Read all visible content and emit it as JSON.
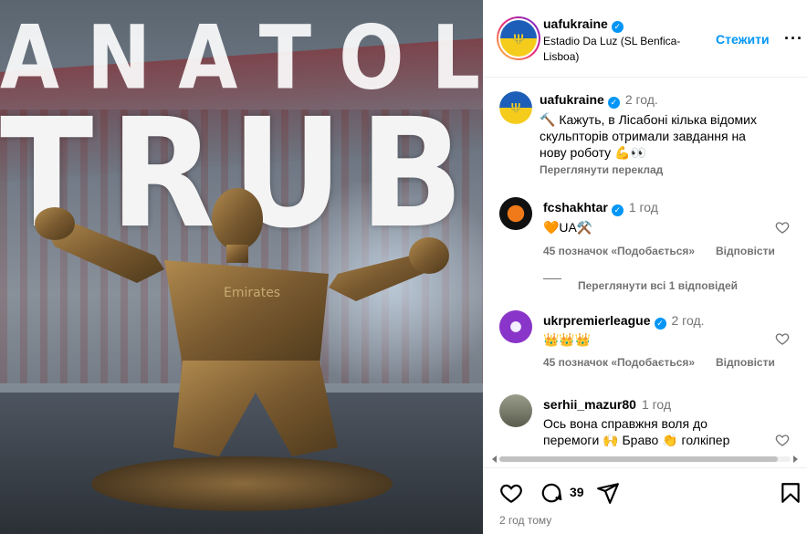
{
  "media": {
    "title_line1": "ANATOLIY",
    "title_line2": "TRUBIN",
    "shirt_text": "Emirates FLY BETTER"
  },
  "header": {
    "username": "uafukraine",
    "location": "Estadio Da Luz (SL Benfica-Lisboa)",
    "follow_label": "Стежити",
    "more_label": "···"
  },
  "caption": {
    "username": "uafukraine",
    "time": "2 год.",
    "text": "🔨 Кажуть, в Лісабоні кілька відомих скульпторів отримали завдання на нову роботу 💪👀",
    "translate_label": "Переглянути переклад"
  },
  "comments": [
    {
      "username": "fcshakhtar",
      "verified": true,
      "time": "1 год",
      "text": "🧡UA⚒️",
      "likes": "45 позначок «Подобається»",
      "reply_label": "Відповісти",
      "view_replies": "Переглянути всі 1 відповідей"
    },
    {
      "username": "ukrpremierleague",
      "verified": true,
      "time": "2 год.",
      "text": "👑👑👑",
      "likes": "45 позначок «Подобається»",
      "reply_label": "Відповісти"
    },
    {
      "username": "serhii_mazur80",
      "verified": false,
      "time": "1 год",
      "text": "Ось вона справжня воля до перемоги 🙌 Браво 👏 голкіпер"
    }
  ],
  "actions": {
    "comment_count": "39",
    "posted_time": "2 год тому"
  },
  "colors": {
    "accent": "#0095f6",
    "muted": "#737373",
    "shakhtar_orange": "#f07a1a",
    "upl_purple": "#8a35c9"
  },
  "icons": [
    "heart-icon",
    "comment-icon",
    "share-icon",
    "bookmark-icon",
    "verified-icon",
    "more-icon"
  ]
}
